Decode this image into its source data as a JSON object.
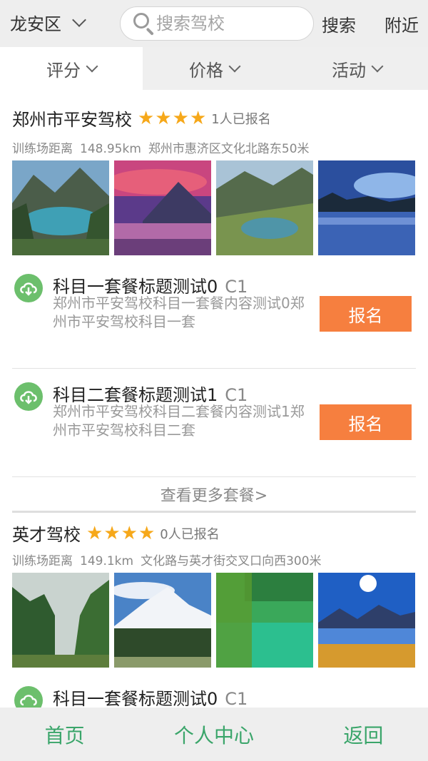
{
  "header": {
    "district": "龙安区",
    "search_placeholder": "搜索驾校",
    "search_label": "搜索",
    "nearby_label": "附近"
  },
  "filters": [
    {
      "label": "评分"
    },
    {
      "label": "价格"
    },
    {
      "label": "活动"
    }
  ],
  "schools": [
    {
      "name": "郑州市平安驾校",
      "stars": 4,
      "enrolled": "1人已报名",
      "distance_label": "训练场距离",
      "distance": "148.95km",
      "address": "郑州市惠济区文化北路东50米",
      "photos": [
        "lake-mountain",
        "purple-sunset-mountain",
        "alpine-lake",
        "blue-lake-night"
      ],
      "packages": [
        {
          "title": "科目一套餐标题测试0",
          "license": "C1",
          "desc": "郑州市平安驾校科目一套餐内容测试0郑州市平安驾校科目一套",
          "button": "报名"
        },
        {
          "title": "科目二套餐标题测试1",
          "license": "C1",
          "desc": "郑州市平安驾校科目二套餐内容测试1郑州市平安驾校科目二套",
          "button": "报名"
        }
      ],
      "more_label": "查看更多套餐>"
    },
    {
      "name": "英才驾校",
      "stars": 4,
      "enrolled": "0人已报名",
      "distance_label": "训练场距离",
      "distance": "149.1km",
      "address": "文化路与英才街交叉口向西300米",
      "photos": [
        "misty-forest",
        "snow-mountain",
        "willow-green",
        "sunny-lake"
      ],
      "packages": [
        {
          "title": "科目一套餐标题测试0",
          "license": "C1"
        }
      ]
    }
  ],
  "bottom_nav": {
    "home": "首页",
    "profile": "个人中心",
    "back": "返回"
  },
  "colors": {
    "accent_orange": "#f67f3f",
    "star": "#f6a81a",
    "nav_green": "#3aa56a",
    "icon_green": "#6cbf6c"
  }
}
